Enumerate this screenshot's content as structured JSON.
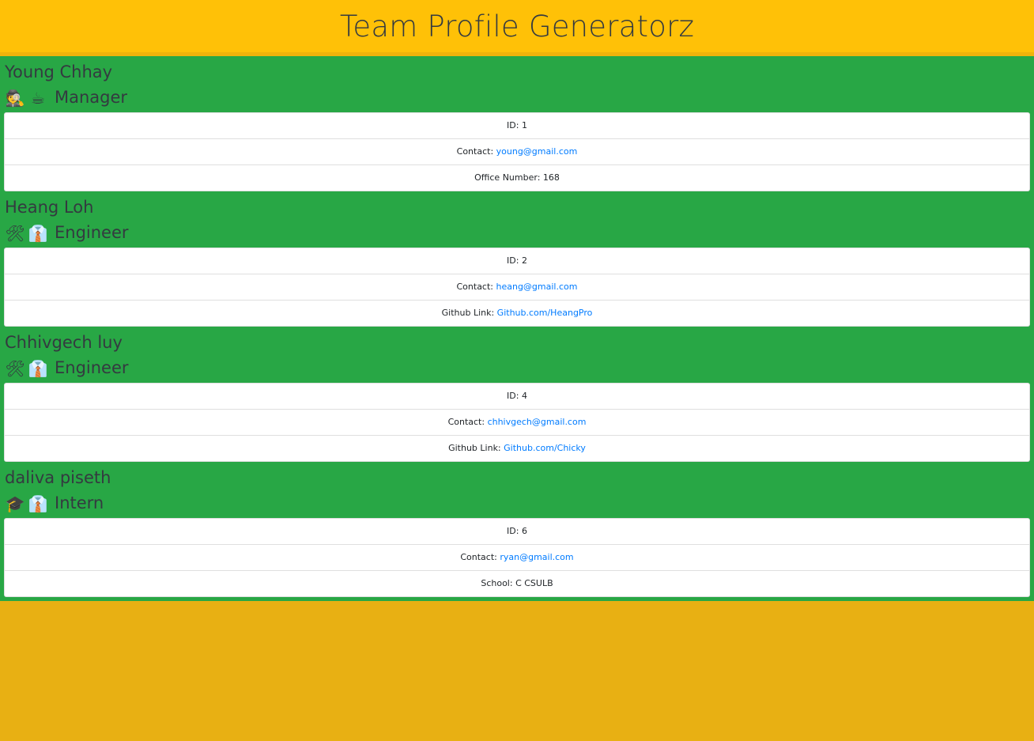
{
  "header": {
    "title": "Team Profile Generatorz"
  },
  "members": [
    {
      "name": "Young Chhay",
      "role": "Manager",
      "icons": [
        "🕵",
        "☕"
      ],
      "id_text": "ID: 1",
      "contact_label": "Contact: ",
      "email": "young@gmail.com",
      "extra_label": "Office Number: 168",
      "extra_link": ""
    },
    {
      "name": "Heang Loh",
      "role": "Engineer",
      "icons": [
        "🛠",
        "👔"
      ],
      "id_text": "ID: 2",
      "contact_label": "Contact: ",
      "email": "heang@gmail.com",
      "extra_label": "Github Link: ",
      "extra_link": "Github.com/HeangPro"
    },
    {
      "name": "Chhivgech luy",
      "role": "Engineer",
      "icons": [
        "🛠",
        "👔"
      ],
      "id_text": "ID: 4",
      "contact_label": "Contact: ",
      "email": "chhivgech@gmail.com",
      "extra_label": "Github Link: ",
      "extra_link": "Github.com/Chicky"
    },
    {
      "name": "daliva piseth",
      "role": "Intern",
      "icons": [
        "🎓",
        "👔"
      ],
      "id_text": "ID: 6",
      "contact_label": "Contact: ",
      "email": "ryan@gmail.com",
      "extra_label": "School: C CSULB",
      "extra_link": ""
    }
  ],
  "colors": {
    "header_bg": "#ffc107",
    "team_bg": "#28a745",
    "page_bg": "#e8b013",
    "link": "#007bff"
  }
}
